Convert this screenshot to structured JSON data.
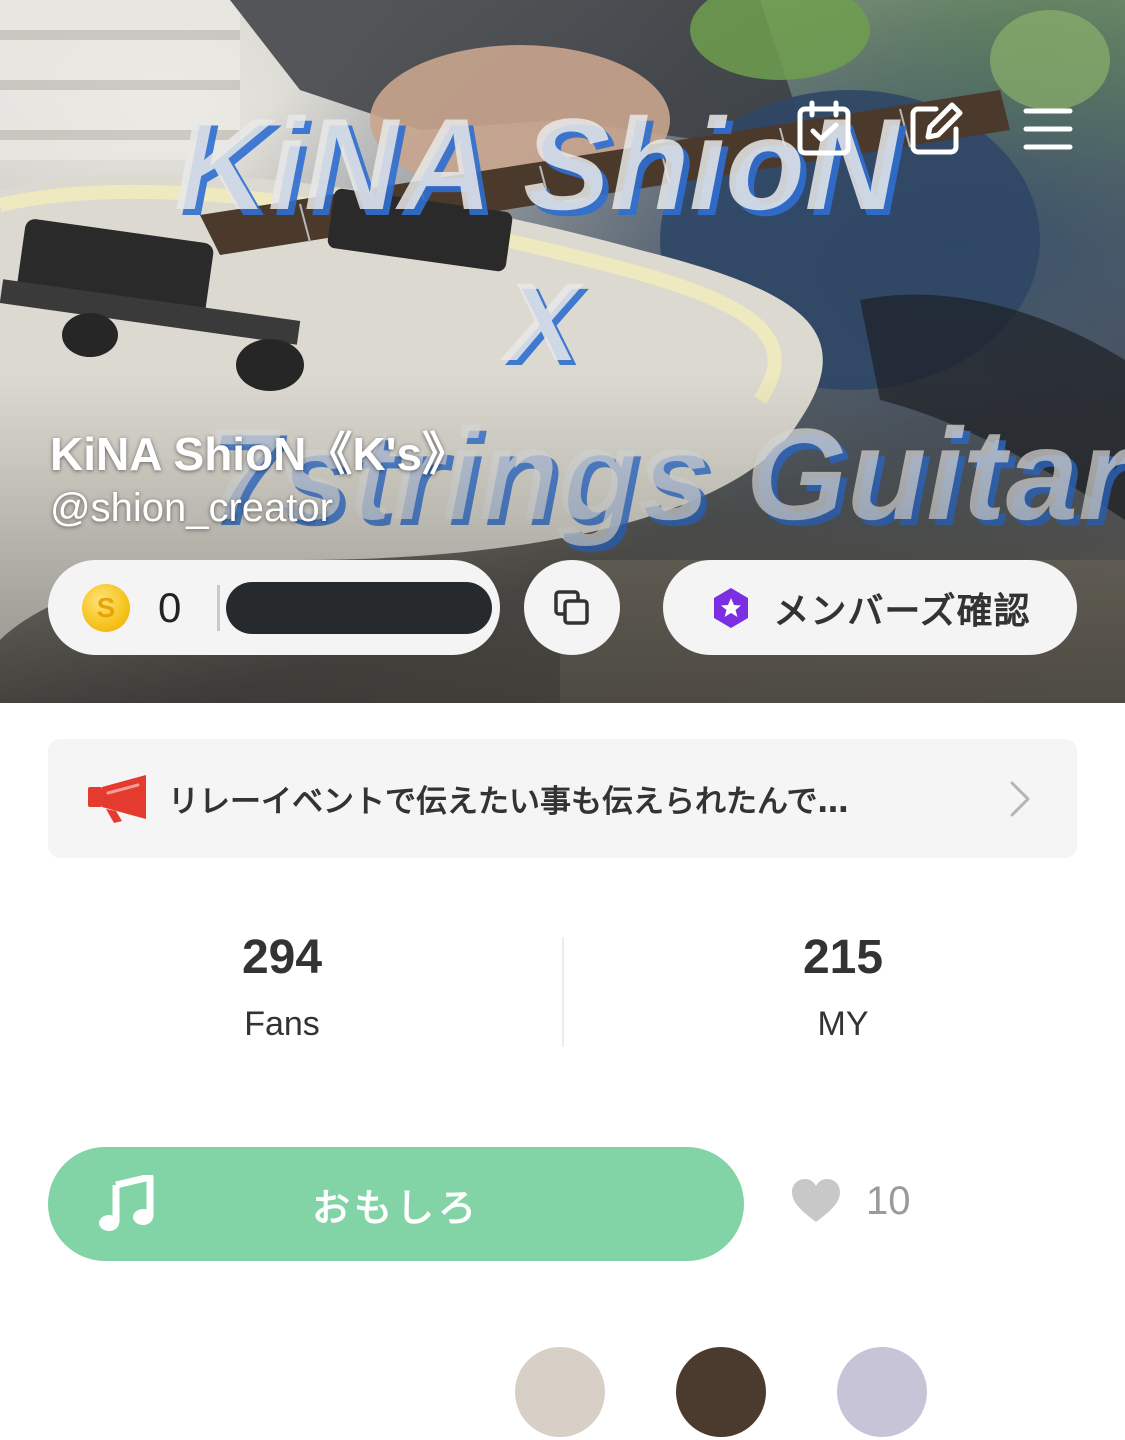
{
  "header": {
    "display_name": "KiNA ShioN《K's》",
    "handle": "@shion_creator",
    "icons": [
      "calendar-check-icon",
      "edit-icon",
      "menu-icon"
    ],
    "banner_text": [
      "KiNA ShioN",
      "X",
      "7strings Guitar"
    ]
  },
  "wallet": {
    "coin_symbol": "S",
    "coin_count": "0"
  },
  "members_button": {
    "label": "メンバーズ確認"
  },
  "announcement": {
    "text": "リレーイベントで伝えたい事も伝えられたんで…"
  },
  "stats": {
    "fans_count": "294",
    "fans_label": "Fans",
    "my_count": "215",
    "my_label": "MY"
  },
  "theme": {
    "label": "おもしろ",
    "accent": "#82d3a6"
  },
  "likes": {
    "count": "10"
  },
  "colors": {
    "badge_purple": "#7a2fe0",
    "announce_red": "#e53b2e",
    "coin_gold": "#f6c31c"
  }
}
